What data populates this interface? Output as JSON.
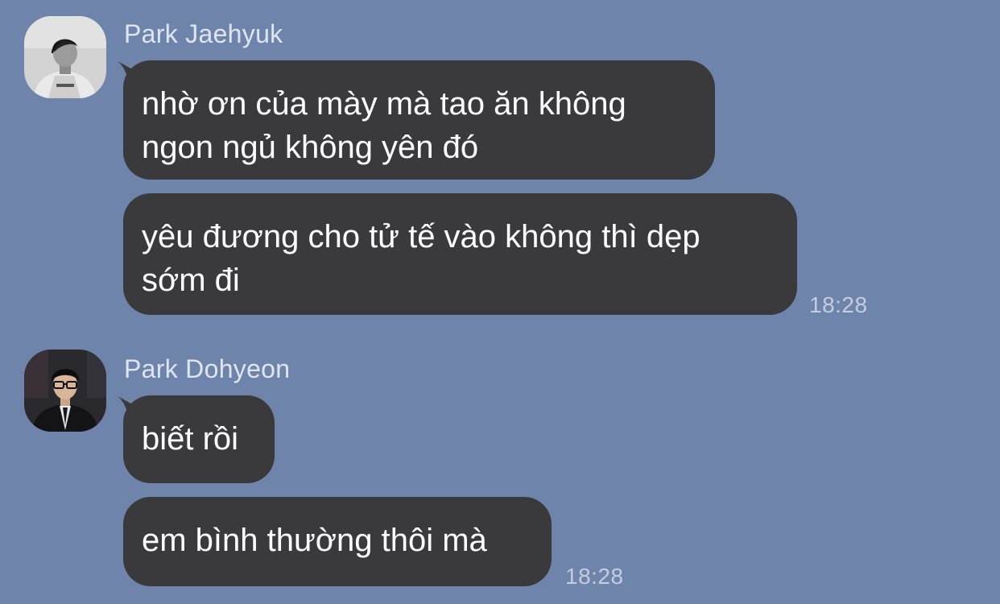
{
  "messages": [
    {
      "sender": "Park Jaehyuk",
      "avatar_icon": "profile-photo-grayscale",
      "bubbles": [
        {
          "line1": "nhờ ơn của mày mà tao ăn không",
          "line2": "ngon ngủ không yên đó"
        },
        {
          "line1": "yêu đương cho tử tế vào không thì dẹp",
          "line2": "sớm đi"
        }
      ],
      "time": "18:28"
    },
    {
      "sender": "Park Dohyeon",
      "avatar_icon": "profile-photo-dark",
      "bubbles": [
        {
          "line1": "biết rồi"
        },
        {
          "line1": "em bình thường thôi mà"
        }
      ],
      "time": "18:28"
    }
  ],
  "colors": {
    "background": "#6f84ab",
    "bubble": "#3a3a3c",
    "bubble_text": "#ffffff",
    "sender_name": "#dfe5f0",
    "timestamp": "#c4cde0"
  }
}
